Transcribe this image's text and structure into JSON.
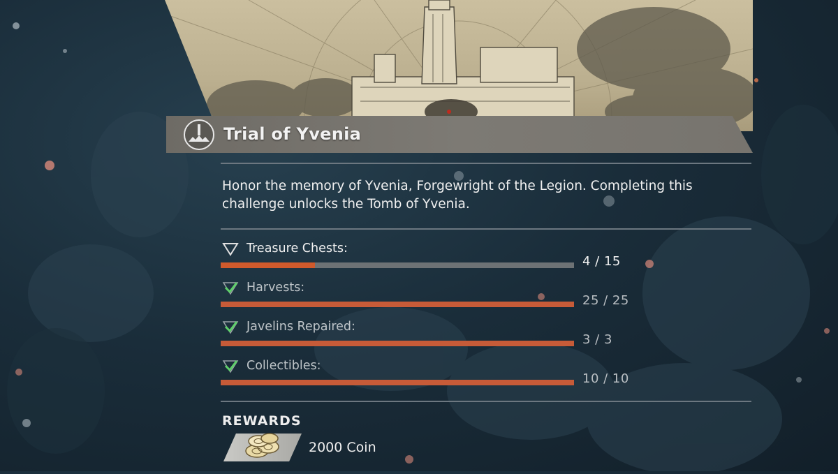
{
  "challenge": {
    "title": "Trial of Yvenia",
    "description": "Honor the memory of Yvenia, Forgewright of the Legion. Completing this challenge unlocks the Tomb of Yvenia."
  },
  "objectives": [
    {
      "label": "Treasure Chests:",
      "count": "4 / 15",
      "progress": 0.267,
      "status": "in-progress"
    },
    {
      "label": "Harvests:",
      "count": "25 / 25",
      "progress": 1.0,
      "status": "complete"
    },
    {
      "label": "Javelins Repaired:",
      "count": "3 / 3",
      "progress": 1.0,
      "status": "complete"
    },
    {
      "label": "Collectibles:",
      "count": "10 / 10",
      "progress": 1.0,
      "status": "complete"
    }
  ],
  "rewards": {
    "heading": "REWARDS",
    "items": [
      {
        "label": "2000 Coin",
        "icon": "coins-icon"
      }
    ]
  },
  "colors": {
    "accent": "#d05a2c",
    "check": "#5fcf6a",
    "panel": "#7a7771"
  }
}
